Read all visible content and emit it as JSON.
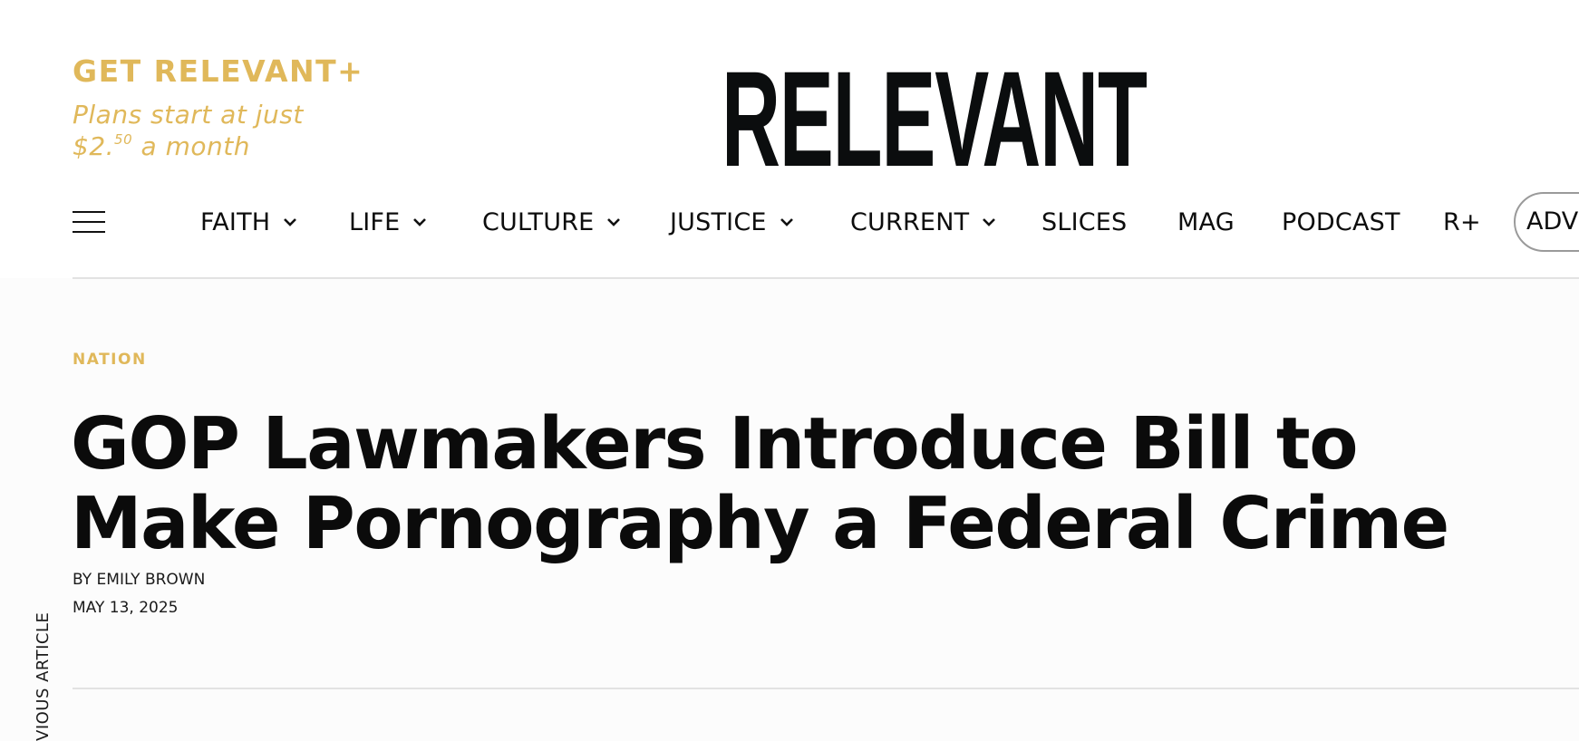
{
  "promo": {
    "title": "GET RELEVANT+",
    "subtitle_line1": "Plans start at just",
    "price_main": "$2.",
    "price_cents": "50",
    "price_suffix": " a month"
  },
  "logo": {
    "text": "RELEVANT"
  },
  "nav": {
    "menu_icon": "hamburger-menu-icon",
    "items": [
      {
        "label": "FAITH",
        "has_dropdown": true
      },
      {
        "label": "LIFE",
        "has_dropdown": true
      },
      {
        "label": "CULTURE",
        "has_dropdown": true
      },
      {
        "label": "JUSTICE",
        "has_dropdown": true
      },
      {
        "label": "CURRENT",
        "has_dropdown": true
      },
      {
        "label": "SLICES",
        "has_dropdown": false
      },
      {
        "label": "MAG",
        "has_dropdown": false
      },
      {
        "label": "PODCAST",
        "has_dropdown": false
      },
      {
        "label": "R+",
        "has_dropdown": false
      }
    ],
    "cta_label": "ADVE"
  },
  "article": {
    "category": "NATION",
    "headline_line1": "GOP Lawmakers Introduce Bill to",
    "headline_line2": "Make Pornography a Federal Crime",
    "byline_prefix": "BY ",
    "author": "EMILY BROWN",
    "date": "MAY 13, 2025"
  },
  "side": {
    "previous_article_label": "VIOUS ARTICLE"
  },
  "colors": {
    "accent": "#e0b85a",
    "text": "#0b0b0b",
    "divider": "#e2e2e2",
    "background": "#fcfcfc"
  }
}
